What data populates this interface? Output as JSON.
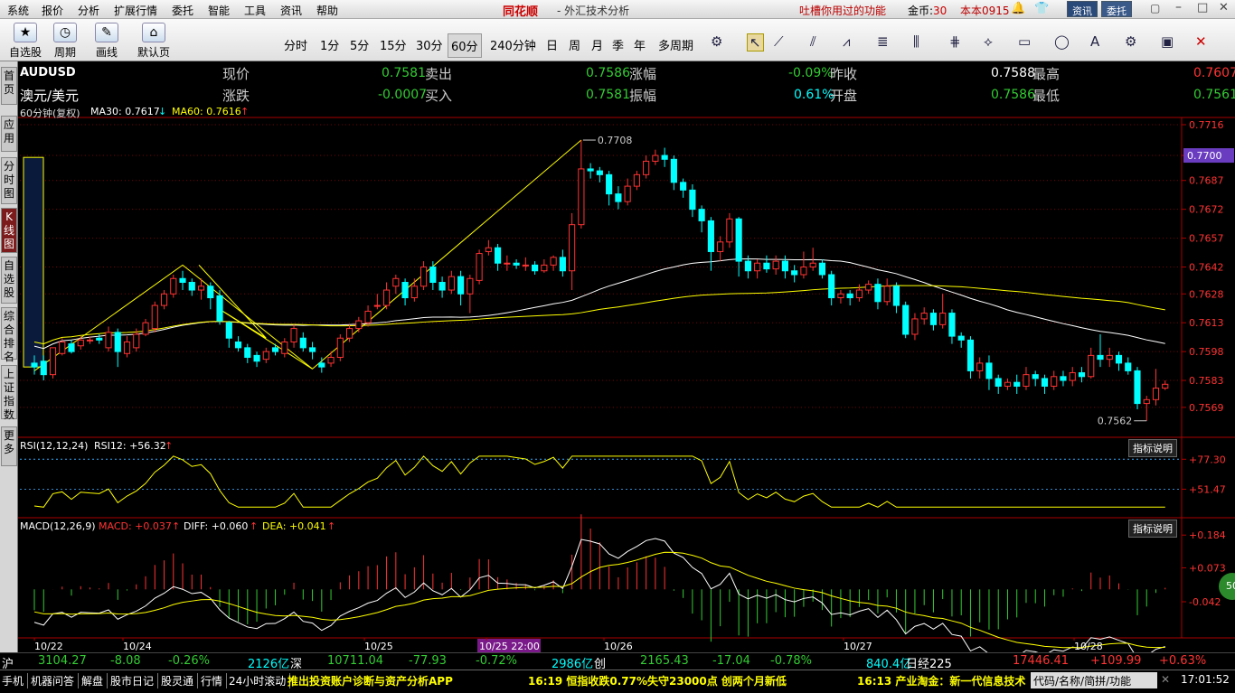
{
  "menu": {
    "items": [
      "系统",
      "报价",
      "分析",
      "扩展行情",
      "委托",
      "智能",
      "工具",
      "资讯",
      "帮助"
    ],
    "brand": "同花顺",
    "title": "- 外汇技术分析",
    "promo": "吐槽你用过的功能",
    "coins_label": "金币:",
    "coins": "30",
    "version": "本本0915",
    "btn_news": "资讯",
    "btn_trade": "委托"
  },
  "toolbar": {
    "self_select": "自选股",
    "period": "周期",
    "draw": "画线",
    "default_page": "默认页",
    "periods": [
      "分时",
      "1分",
      "5分",
      "15分",
      "30分",
      "60分",
      "240分钟",
      "日",
      "周",
      "月",
      "季",
      "年",
      "多周期"
    ],
    "selected_period": "60分"
  },
  "sidebar": {
    "tabs": [
      "首页",
      "应用",
      "分时图",
      "K线图",
      "自选股",
      "综合排名",
      "上证指数",
      "更多"
    ],
    "active": "K线图"
  },
  "quote": {
    "code": "AUDUSD",
    "name": "澳元/美元",
    "cells": [
      {
        "label": "现价",
        "value": "0.7581",
        "color": "g"
      },
      {
        "label": "卖出",
        "value": "0.7586",
        "color": "g"
      },
      {
        "label": "涨幅",
        "value": "-0.09%",
        "color": "g"
      },
      {
        "label": "昨收",
        "value": "0.7588",
        "color": "w"
      },
      {
        "label": "最高",
        "value": "0.7607",
        "color": "r"
      },
      {
        "label": "涨跌",
        "value": "-0.0007",
        "color": "g"
      },
      {
        "label": "买入",
        "value": "0.7581",
        "color": "g"
      },
      {
        "label": "振幅",
        "value": "0.61%",
        "color": "c"
      },
      {
        "label": "开盘",
        "value": "0.7586",
        "color": "g"
      },
      {
        "label": "最低",
        "value": "0.7561",
        "color": "g"
      }
    ]
  },
  "indicators": {
    "kline_title": "60分钟(复权)",
    "ma30": "MA30: 0.7617",
    "ma60": "MA60: 0.7616",
    "rsi_title": "RSI(12,12,24)",
    "rsi12": "RSI12: +56.32",
    "macd_title": "MACD(12,26,9)",
    "macd": "MACD: +0.037",
    "diff": "DIFF: +0.060",
    "dea": "DEA: +0.041",
    "explain": "指标说明"
  },
  "chart_data": {
    "type": "candlestick",
    "symbol": "AUDUSD",
    "interval": "60分",
    "price_ticks": [
      "0.7716",
      "0.7700",
      "0.7687",
      "0.7672",
      "0.7657",
      "0.7642",
      "0.7628",
      "0.7613",
      "0.7598",
      "0.7583",
      "0.7569"
    ],
    "current_price": "0.7700",
    "high_label": "0.7708",
    "low_label": "0.7562",
    "rsi_ticks": [
      "+77.30",
      "+51.47"
    ],
    "macd_ticks": [
      "+0.184",
      "+0.073",
      "-0.042"
    ],
    "dates": [
      "10/22",
      "10/24",
      "10/25",
      "10/25 22:00",
      "10/26",
      "10/27",
      "10/28"
    ],
    "candles": [
      [
        0.7592,
        0.759,
        0.7596,
        0.7586
      ],
      [
        0.7593,
        0.7586,
        0.7596,
        0.7583
      ],
      [
        0.7586,
        0.76,
        0.76,
        0.7584
      ],
      [
        0.7597,
        0.7603,
        0.7605,
        0.7596
      ],
      [
        0.7602,
        0.7598,
        0.7604,
        0.7597
      ],
      [
        0.7601,
        0.7604,
        0.7606,
        0.7599
      ],
      [
        0.7604,
        0.7604,
        0.7606,
        0.7602
      ],
      [
        0.7605,
        0.7604,
        0.7607,
        0.7602
      ],
      [
        0.76,
        0.7608,
        0.7611,
        0.7598
      ],
      [
        0.7608,
        0.7598,
        0.761,
        0.759
      ],
      [
        0.7597,
        0.7603,
        0.7606,
        0.7595
      ],
      [
        0.76,
        0.7607,
        0.761,
        0.7598
      ],
      [
        0.7607,
        0.7613,
        0.7615,
        0.7606
      ],
      [
        0.761,
        0.7622,
        0.7624,
        0.7608
      ],
      [
        0.7622,
        0.7628,
        0.763,
        0.762
      ],
      [
        0.7628,
        0.7636,
        0.7638,
        0.7626
      ],
      [
        0.7636,
        0.7634,
        0.764,
        0.763
      ],
      [
        0.7634,
        0.763,
        0.7636,
        0.7627
      ],
      [
        0.763,
        0.7632,
        0.7636,
        0.7625
      ],
      [
        0.7632,
        0.7626,
        0.7634,
        0.762
      ],
      [
        0.7627,
        0.7614,
        0.763,
        0.7612
      ],
      [
        0.7613,
        0.7605,
        0.7614,
        0.76
      ],
      [
        0.7603,
        0.76,
        0.7606,
        0.7598
      ],
      [
        0.76,
        0.7595,
        0.7602,
        0.7592
      ],
      [
        0.7596,
        0.7593,
        0.7598,
        0.759
      ],
      [
        0.7594,
        0.7598,
        0.76,
        0.7592
      ],
      [
        0.76,
        0.7598,
        0.7602,
        0.7596
      ],
      [
        0.7597,
        0.7603,
        0.7605,
        0.7595
      ],
      [
        0.7603,
        0.761,
        0.7612,
        0.76
      ],
      [
        0.7605,
        0.76,
        0.7608,
        0.7598
      ],
      [
        0.76,
        0.7598,
        0.7603,
        0.7594
      ],
      [
        0.7592,
        0.759,
        0.7595,
        0.7587
      ],
      [
        0.7592,
        0.7595,
        0.7598,
        0.759
      ],
      [
        0.7595,
        0.7605,
        0.7607,
        0.7593
      ],
      [
        0.7605,
        0.761,
        0.7612,
        0.7603
      ],
      [
        0.761,
        0.7614,
        0.7616,
        0.7608
      ],
      [
        0.7613,
        0.7619,
        0.7622,
        0.7611
      ],
      [
        0.7622,
        0.7622,
        0.7628,
        0.762
      ],
      [
        0.7622,
        0.763,
        0.7634,
        0.762
      ],
      [
        0.7632,
        0.7636,
        0.7638,
        0.7628
      ],
      [
        0.7634,
        0.7626,
        0.7636,
        0.7622
      ],
      [
        0.7626,
        0.7632,
        0.7636,
        0.7624
      ],
      [
        0.7632,
        0.7642,
        0.7645,
        0.763
      ],
      [
        0.7642,
        0.7634,
        0.7645,
        0.763
      ],
      [
        0.7634,
        0.763,
        0.7637,
        0.7626
      ],
      [
        0.763,
        0.7637,
        0.764,
        0.7628
      ],
      [
        0.7637,
        0.7628,
        0.764,
        0.7622
      ],
      [
        0.7628,
        0.7636,
        0.7638,
        0.7618
      ],
      [
        0.7635,
        0.7649,
        0.7651,
        0.7633
      ],
      [
        0.765,
        0.7652,
        0.7656,
        0.7648
      ],
      [
        0.7652,
        0.7644,
        0.7654,
        0.764
      ],
      [
        0.7644,
        0.7644,
        0.7648,
        0.764
      ],
      [
        0.7644,
        0.7643,
        0.7646,
        0.7641
      ],
      [
        0.7643,
        0.7643,
        0.7647,
        0.764
      ],
      [
        0.7643,
        0.764,
        0.7645,
        0.7638
      ],
      [
        0.764,
        0.7643,
        0.7646,
        0.7639
      ],
      [
        0.7643,
        0.7647,
        0.7648,
        0.764
      ],
      [
        0.7647,
        0.764,
        0.7651,
        0.7637
      ],
      [
        0.764,
        0.7664,
        0.767,
        0.763
      ],
      [
        0.7664,
        0.7693,
        0.7708,
        0.7662
      ],
      [
        0.7693,
        0.7692,
        0.7696,
        0.7688
      ],
      [
        0.7692,
        0.769,
        0.7694,
        0.7686
      ],
      [
        0.769,
        0.768,
        0.7692,
        0.7674
      ],
      [
        0.768,
        0.7676,
        0.7684,
        0.7672
      ],
      [
        0.7676,
        0.7684,
        0.7688,
        0.7674
      ],
      [
        0.7684,
        0.769,
        0.7692,
        0.7682
      ],
      [
        0.769,
        0.7697,
        0.77,
        0.7688
      ],
      [
        0.7697,
        0.77,
        0.7703,
        0.7695
      ],
      [
        0.77,
        0.7698,
        0.7704,
        0.7694
      ],
      [
        0.7698,
        0.7686,
        0.77,
        0.7682
      ],
      [
        0.7686,
        0.7682,
        0.7688,
        0.7678
      ],
      [
        0.7682,
        0.7672,
        0.7685,
        0.7668
      ],
      [
        0.7672,
        0.7666,
        0.7674,
        0.766
      ],
      [
        0.7666,
        0.765,
        0.7668,
        0.764
      ],
      [
        0.765,
        0.7655,
        0.7658,
        0.7645
      ],
      [
        0.7655,
        0.7667,
        0.767,
        0.7652
      ],
      [
        0.7667,
        0.7645,
        0.7668,
        0.7637
      ],
      [
        0.7645,
        0.764,
        0.7648,
        0.7636
      ],
      [
        0.764,
        0.7644,
        0.7646,
        0.7636
      ],
      [
        0.7644,
        0.7641,
        0.7648,
        0.7639
      ],
      [
        0.7641,
        0.7645,
        0.7648,
        0.7638
      ],
      [
        0.7645,
        0.764,
        0.7648,
        0.7636
      ],
      [
        0.764,
        0.7638,
        0.7643,
        0.7634
      ],
      [
        0.7638,
        0.7642,
        0.765,
        0.7636
      ],
      [
        0.7642,
        0.7644,
        0.7652,
        0.764
      ],
      [
        0.7644,
        0.7638,
        0.7646,
        0.7636
      ],
      [
        0.7638,
        0.7626,
        0.764,
        0.7622
      ],
      [
        0.7626,
        0.7628,
        0.763,
        0.7623
      ],
      [
        0.7628,
        0.7626,
        0.763,
        0.7622
      ],
      [
        0.7626,
        0.763,
        0.7633,
        0.7624
      ],
      [
        0.763,
        0.7633,
        0.7635,
        0.7628
      ],
      [
        0.7633,
        0.7624,
        0.7636,
        0.762
      ],
      [
        0.7624,
        0.7632,
        0.7636,
        0.7622
      ],
      [
        0.7632,
        0.7622,
        0.7634,
        0.7618
      ],
      [
        0.7622,
        0.7607,
        0.7624,
        0.7605
      ],
      [
        0.7607,
        0.7615,
        0.7618,
        0.7604
      ],
      [
        0.7615,
        0.7618,
        0.7621,
        0.7612
      ],
      [
        0.7618,
        0.7612,
        0.762,
        0.7609
      ],
      [
        0.7612,
        0.7618,
        0.7628,
        0.761
      ],
      [
        0.7618,
        0.7606,
        0.762,
        0.7602
      ],
      [
        0.7606,
        0.7604,
        0.7608,
        0.76
      ],
      [
        0.7604,
        0.7588,
        0.7606,
        0.7584
      ],
      [
        0.7588,
        0.7592,
        0.7595,
        0.7584
      ],
      [
        0.7592,
        0.7584,
        0.7596,
        0.7578
      ],
      [
        0.7584,
        0.758,
        0.7586,
        0.7576
      ],
      [
        0.758,
        0.7582,
        0.7584,
        0.7578
      ],
      [
        0.7582,
        0.758,
        0.7586,
        0.7576
      ],
      [
        0.758,
        0.7586,
        0.759,
        0.7578
      ],
      [
        0.7586,
        0.7584,
        0.7588,
        0.758
      ],
      [
        0.7584,
        0.758,
        0.7586,
        0.7576
      ],
      [
        0.758,
        0.7585,
        0.7588,
        0.7578
      ],
      [
        0.7585,
        0.7583,
        0.7588,
        0.758
      ],
      [
        0.7583,
        0.7587,
        0.759,
        0.758
      ],
      [
        0.7587,
        0.7585,
        0.759,
        0.7582
      ],
      [
        0.7585,
        0.7596,
        0.76,
        0.7584
      ],
      [
        0.7596,
        0.7594,
        0.7607,
        0.759
      ],
      [
        0.7594,
        0.7596,
        0.76,
        0.759
      ],
      [
        0.7596,
        0.7592,
        0.7598,
        0.7588
      ],
      [
        0.7592,
        0.7588,
        0.7595,
        0.7586
      ],
      [
        0.7588,
        0.7571,
        0.759,
        0.7568
      ],
      [
        0.7571,
        0.7573,
        0.7575,
        0.7562
      ],
      [
        0.7573,
        0.7579,
        0.7589,
        0.757
      ],
      [
        0.7579,
        0.7581,
        0.7583,
        0.7578
      ]
    ]
  },
  "ticker": {
    "sh_label": "沪",
    "sh_val": "3104.27",
    "sh_chg": "-8.08",
    "sh_pct": "-0.26%",
    "sh_amt": "2126亿",
    "sz_label": "深",
    "sz_val": "10711.04",
    "sz_chg": "-77.93",
    "sz_pct": "-0.72%",
    "sz_amt": "2986亿",
    "cy_label": "创",
    "cy_val": "2165.43",
    "cy_chg": "-17.04",
    "cy_pct": "-0.78%",
    "cy_amt": "840.4亿",
    "nk_label": "日经225",
    "nk_val": "17446.41",
    "nk_chg": "+109.99",
    "nk_pct": "+0.63%"
  },
  "status": {
    "tabs": [
      "手机",
      "机器问答",
      "解盘",
      "股市日记",
      "股灵通",
      "行情",
      "24小时滚动"
    ],
    "news1": "推出投资账户诊断与资产分析APP",
    "news2": "16:19 恒指收跌0.77%失守23000点 创两个月新低",
    "news3": "16:13 产业淘金：新一代信息技术",
    "search": "代码/名称/简拼/功能",
    "clock": "17:01:52"
  }
}
